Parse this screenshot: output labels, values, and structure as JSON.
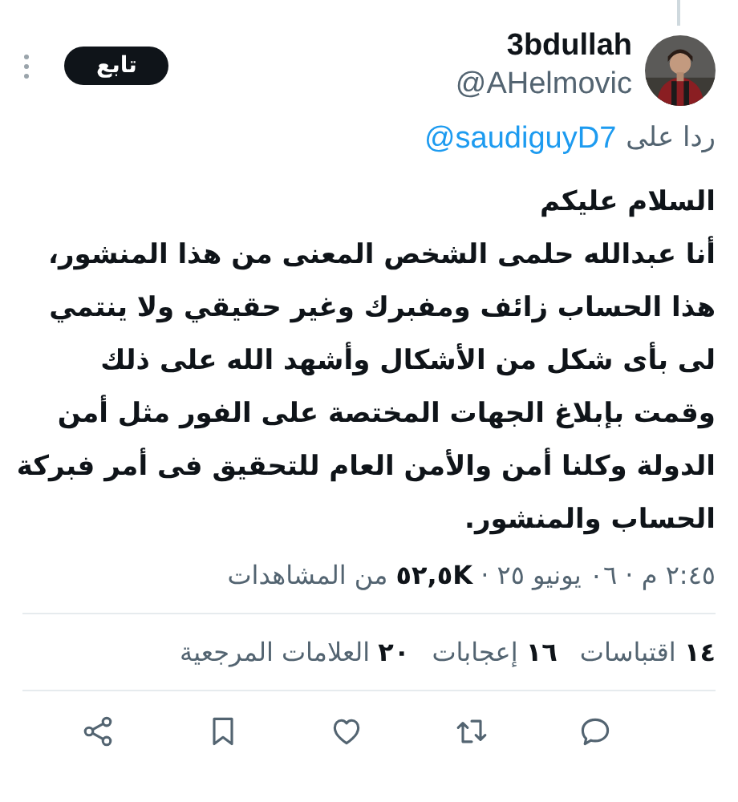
{
  "author": {
    "name": "3bdullah",
    "handle": "@AHelmovic"
  },
  "follow_button": "تابع",
  "reply_to": {
    "prefix": "ردا على",
    "handle": "@saudiguyD7"
  },
  "body": "السلام عليكم\nأنا عبدالله حلمى الشخص المعنى من هذا المنشور،\nهذا الحساب زائف ومفبرك وغير حقيقي ولا ينتمي\nلى بأى شكل من الأشكال وأشهد الله على ذلك\nوقمت بإبلاغ الجهات المختصة على الفور مثل أمن\nالدولة وكلنا أمن والأمن العام للتحقيق فى أمر فبركة\nالحساب والمنشور.",
  "meta": "٢:٤٥ م · ٠٦ يونيو ٢٥ · **٥٢,٥K** من المشاهدات",
  "stats": [
    "**١٤** اقتباسات",
    "**١٦** إعجابات",
    "**٢٠** العلامات المرجعية"
  ],
  "actions": [
    {
      "kind": "reply"
    },
    {
      "kind": "repost"
    },
    {
      "kind": "like"
    },
    {
      "kind": "bookmark"
    },
    {
      "kind": "share"
    }
  ]
}
